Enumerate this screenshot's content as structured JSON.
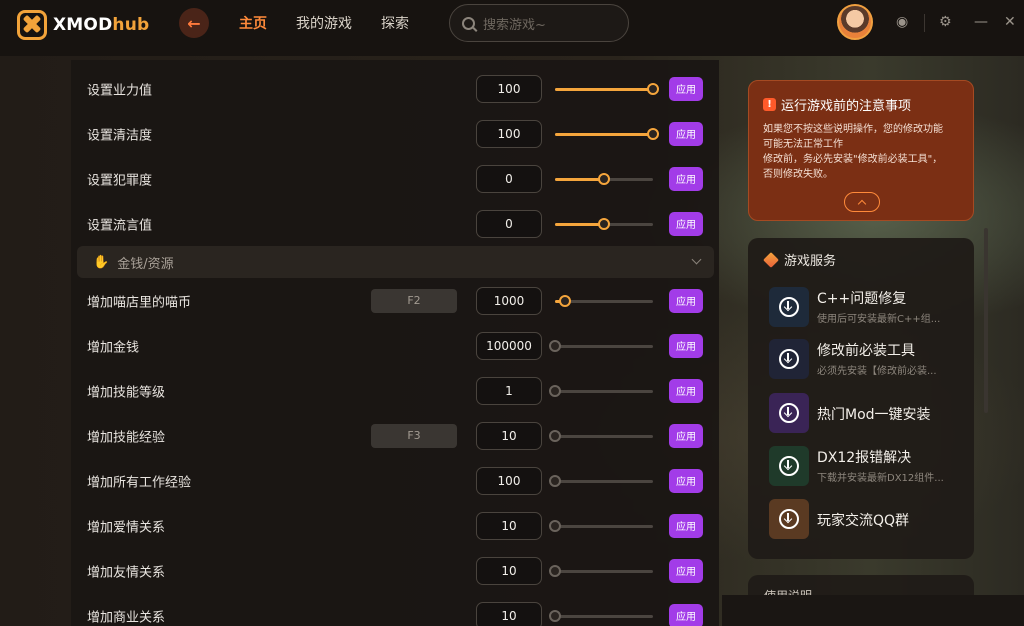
{
  "app": {
    "logo_text": "XMOD",
    "logo_text_accent": "hub"
  },
  "nav": {
    "items": [
      {
        "label": "主页",
        "active": true
      },
      {
        "label": "我的游戏",
        "active": false
      },
      {
        "label": "探索",
        "active": false
      }
    ]
  },
  "search": {
    "placeholder": "搜索游戏~"
  },
  "colors": {
    "accent": "#ff8a3a",
    "apply_button": "#a23ce8",
    "notice_bg": "#7b2f14"
  },
  "panel": {
    "apply_label": "应用",
    "rows_top": [
      {
        "label": "设置业力值",
        "value": "100",
        "level": 1.0
      },
      {
        "label": "设置清洁度",
        "value": "100",
        "level": 1.0
      },
      {
        "label": "设置犯罪度",
        "value": "0",
        "level": 0.5
      },
      {
        "label": "设置流言值",
        "value": "0",
        "level": 0.5
      }
    ],
    "section": {
      "icon": "hand-coin-icon",
      "label": "金钱/资源"
    },
    "rows_bottom": [
      {
        "label": "增加喵店里的喵币",
        "hotkey": "F2",
        "value": "1000",
        "level": 0.1
      },
      {
        "label": "增加金钱",
        "hotkey": "",
        "value": "100000",
        "level": 0
      },
      {
        "label": "增加技能等级",
        "hotkey": "",
        "value": "1",
        "level": 0
      },
      {
        "label": "增加技能经验",
        "hotkey": "F3",
        "value": "10",
        "level": 0
      },
      {
        "label": "增加所有工作经验",
        "hotkey": "",
        "value": "100",
        "level": 0
      },
      {
        "label": "增加爱情关系",
        "hotkey": "",
        "value": "10",
        "level": 0
      },
      {
        "label": "增加友情关系",
        "hotkey": "",
        "value": "10",
        "level": 0
      },
      {
        "label": "增加商业关系",
        "hotkey": "",
        "value": "10",
        "level": 0
      }
    ]
  },
  "notice": {
    "title": "运行游戏前的注意事项",
    "line1": "如果您不按这些说明操作，您的修改功能",
    "line2": "可能无法正常工作",
    "line3": "修改前，务必先安装\"修改前必装工具\"，",
    "line4": "否则修改失败。"
  },
  "services": {
    "title": "游戏服务",
    "items": [
      {
        "title": "C++问题修复",
        "subtitle": "使用后可安装最新C++组...",
        "thumb_color": "#1e2a3a"
      },
      {
        "title": "修改前必装工具",
        "subtitle": "必须先安装【修改前必装...",
        "thumb_color": "#202436"
      },
      {
        "title": "热门Mod一键安装",
        "subtitle": "",
        "thumb_color": "#3a2456"
      },
      {
        "title": "DX12报错解决",
        "subtitle": "下载并安装最新DX12组件...",
        "thumb_color": "#1f3a2a"
      },
      {
        "title": "玩家交流QQ群",
        "subtitle": "",
        "thumb_color": "#5a3a22"
      }
    ]
  },
  "usage": {
    "title": "使用说明"
  }
}
